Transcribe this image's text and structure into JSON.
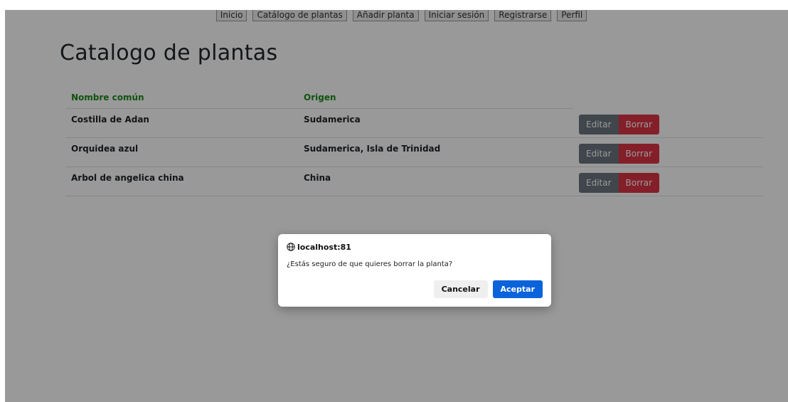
{
  "nav": {
    "items": [
      {
        "label": "Inicio"
      },
      {
        "label": "Catálogo de plantas"
      },
      {
        "label": "Añadir planta"
      },
      {
        "label": "Iniciar sesión"
      },
      {
        "label": "Registrarse"
      },
      {
        "label": "Perfil"
      }
    ]
  },
  "main": {
    "title": "Catalogo de plantas",
    "table": {
      "headers": [
        "Nombre común",
        "Origen"
      ],
      "rows": [
        {
          "name": "Costilla de Adan",
          "origin": "Sudamerica"
        },
        {
          "name": "Orquidea azul",
          "origin": "Sudamerica, Isla de Trinidad"
        },
        {
          "name": "Arbol de angelica china",
          "origin": "China"
        }
      ],
      "edit_label": "Editar",
      "delete_label": "Borrar"
    }
  },
  "dialog": {
    "origin": "localhost:81",
    "message": "¿Estás seguro de que quieres borrar la planta?",
    "cancel_label": "Cancelar",
    "accept_label": "Aceptar",
    "icon": "globe-icon"
  },
  "colors": {
    "header_text": "#1a8a1a",
    "edit_button": "#6c757d",
    "delete_button": "#dc3545",
    "accept_button": "#0b63db"
  }
}
